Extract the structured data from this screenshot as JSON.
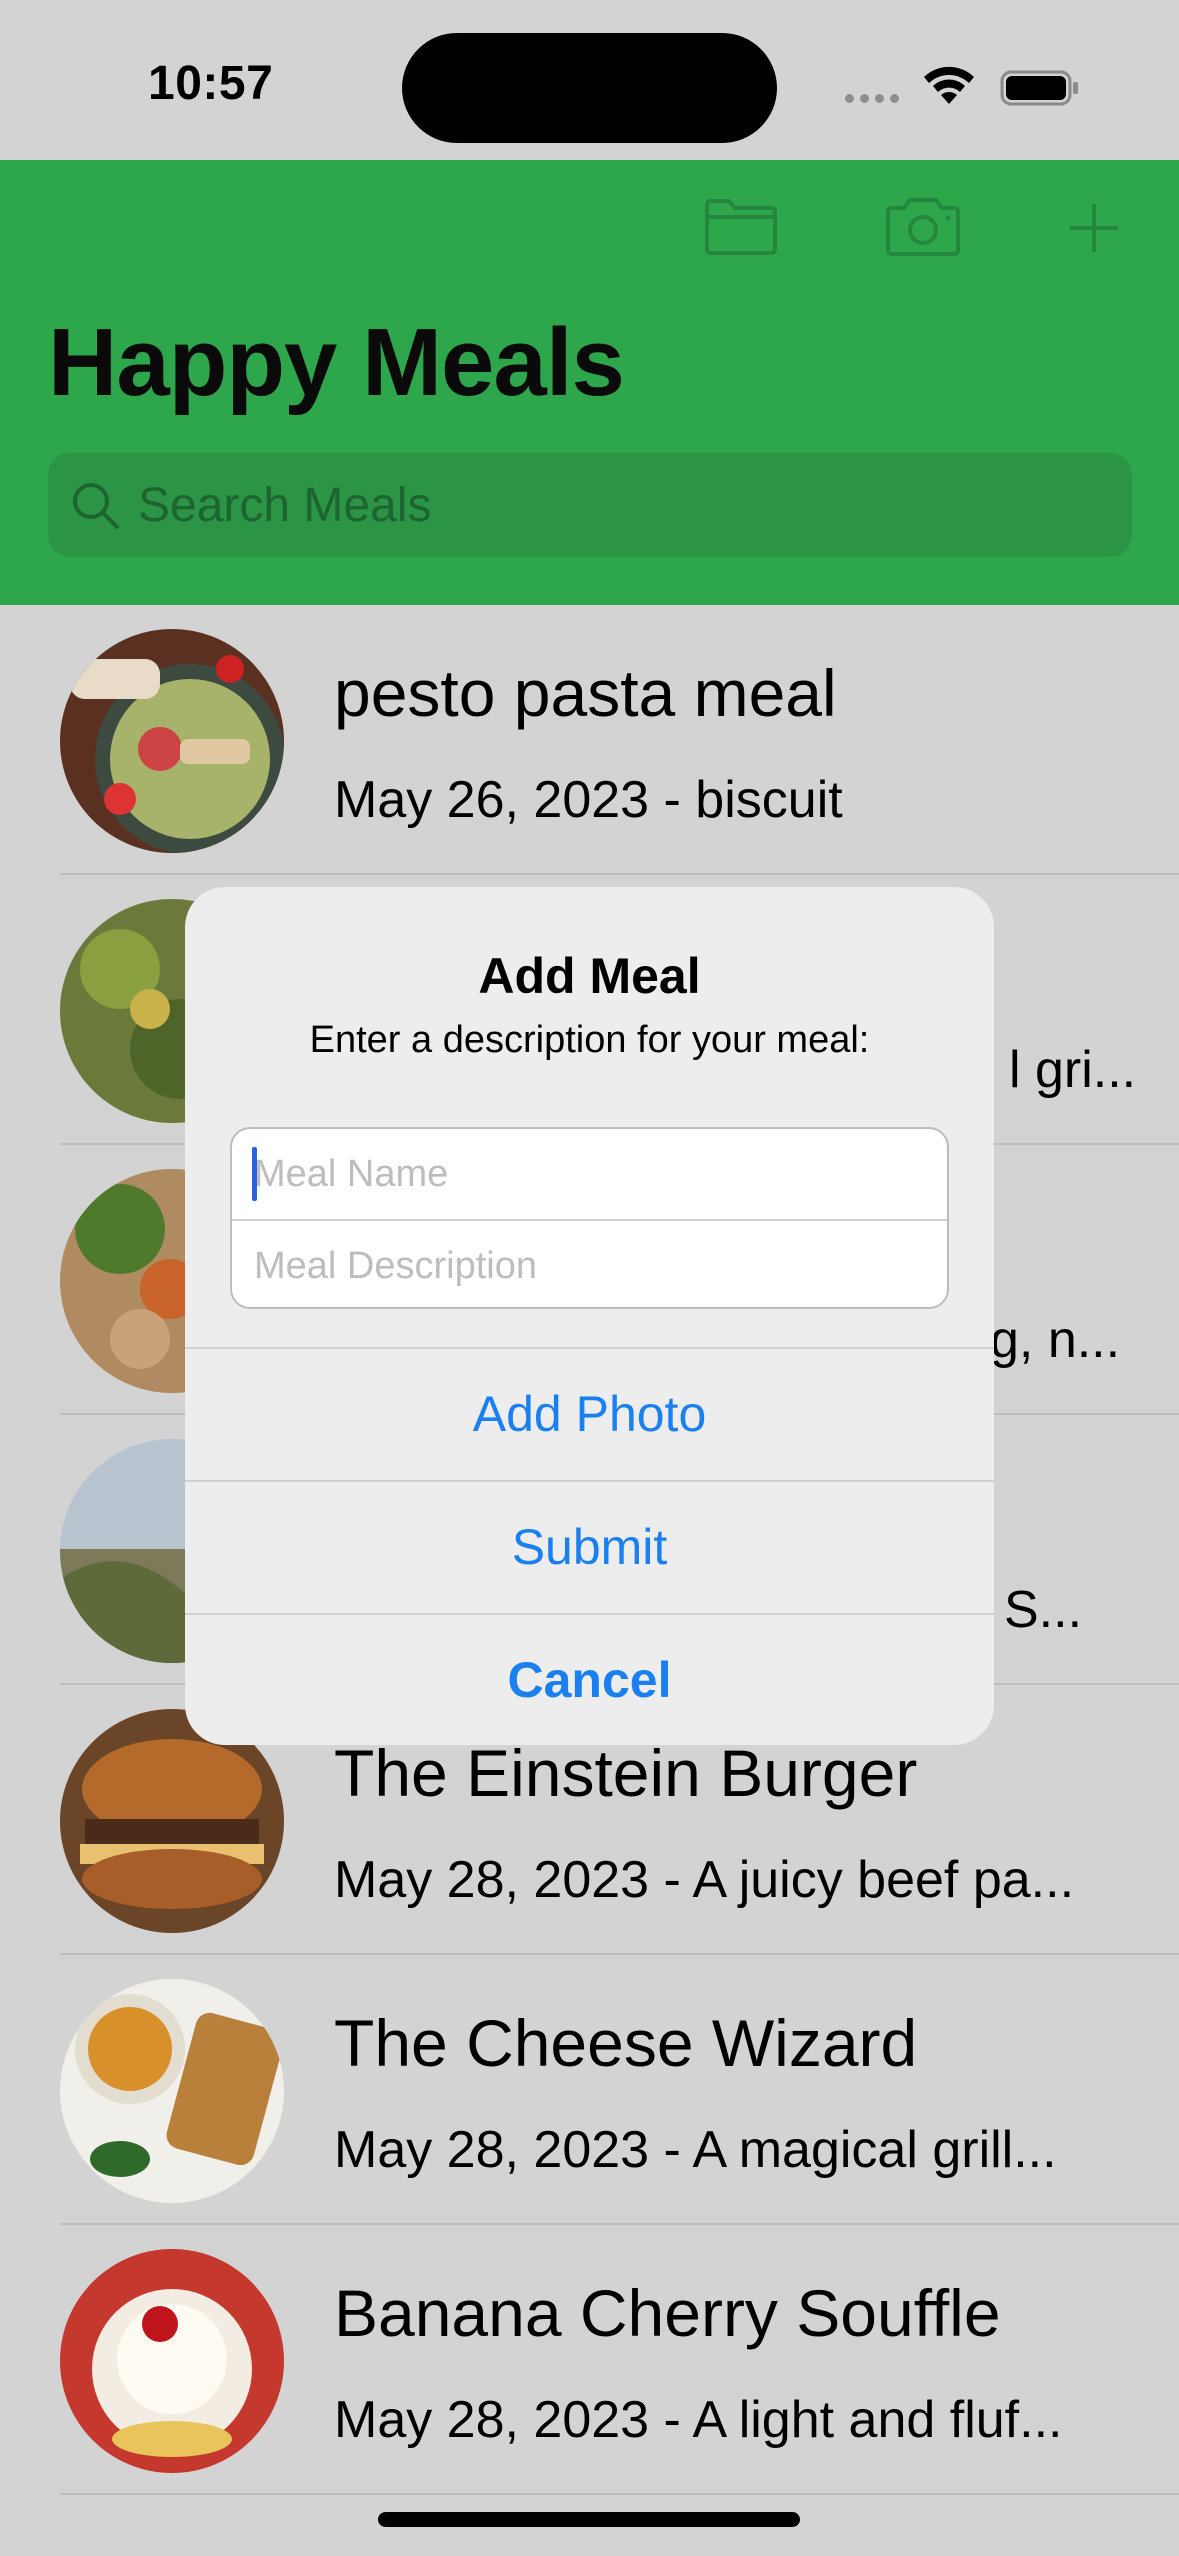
{
  "status": {
    "time": "10:57"
  },
  "header": {
    "title": "Happy Meals",
    "search_placeholder": "Search Meals"
  },
  "meals": [
    {
      "title": "pesto pasta meal",
      "subtitle": "May 26, 2023 - biscuit"
    },
    {
      "title": "",
      "subtitle": "l gri..."
    },
    {
      "title": "",
      "subtitle": "g, n..."
    },
    {
      "title": "",
      "subtitle": "S..."
    },
    {
      "title": "The Einstein Burger",
      "subtitle": "May 28, 2023 - A juicy beef pa..."
    },
    {
      "title": "The Cheese Wizard",
      "subtitle": "May 28, 2023 - A magical grill..."
    },
    {
      "title": "Banana Cherry Souffle",
      "subtitle": "May 28, 2023 - A light and fluf..."
    }
  ],
  "dialog": {
    "title": "Add Meal",
    "message": "Enter a description for your meal:",
    "name_placeholder": "Meal Name",
    "description_placeholder": "Meal Description",
    "add_photo": "Add Photo",
    "submit": "Submit",
    "cancel": "Cancel"
  },
  "colors": {
    "header_green": "#2ea74c",
    "action_blue": "#1a80f0",
    "dim_background": "#d3d3d3"
  }
}
